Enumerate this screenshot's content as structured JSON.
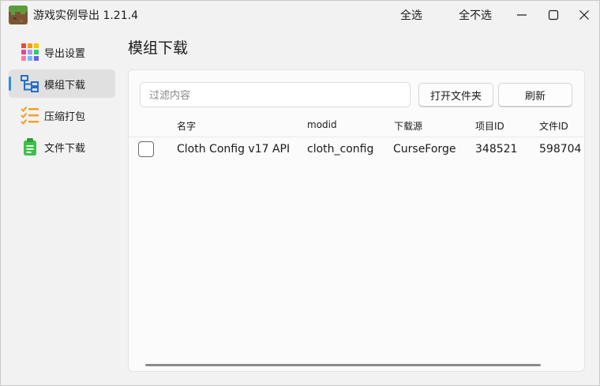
{
  "app": {
    "title": "游戏实例导出 1.21.4",
    "select_all": "全选",
    "select_none": "全不选"
  },
  "sidebar": {
    "items": [
      {
        "label": "导出设置",
        "icon": "export-settings-grid-icon",
        "active": false
      },
      {
        "label": "模组下载",
        "icon": "mod-download-tree-icon",
        "active": true
      },
      {
        "label": "压缩打包",
        "icon": "checklist-icon",
        "active": false
      },
      {
        "label": "文件下载",
        "icon": "clipboard-icon",
        "active": false
      }
    ]
  },
  "main": {
    "title": "模组下载",
    "filter_placeholder": "过滤内容",
    "open_folder_label": "打开文件夹",
    "refresh_label": "刷新",
    "columns": [
      "名字",
      "modid",
      "下载源",
      "项目ID",
      "文件ID"
    ],
    "rows": [
      {
        "name": "Cloth Config v17 API",
        "modid": "cloth_config",
        "source": "CurseForge",
        "project_id": "348521",
        "file_id": "598704",
        "checked": false
      }
    ]
  },
  "colors": {
    "accent": "#2f8fdc",
    "background": "#f2f2f2",
    "panel": "#fbfbfb"
  }
}
